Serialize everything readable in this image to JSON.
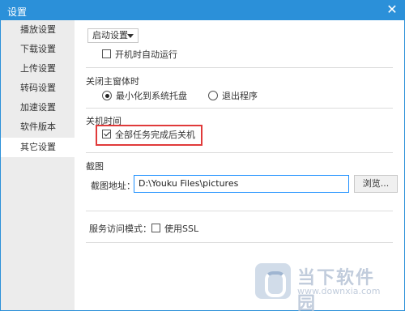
{
  "window": {
    "title": "设置",
    "close_glyph": "✕"
  },
  "sidebar": {
    "items": [
      {
        "label": "播放设置"
      },
      {
        "label": "下载设置"
      },
      {
        "label": "上传设置"
      },
      {
        "label": "转码设置"
      },
      {
        "label": "加速设置"
      },
      {
        "label": "软件版本"
      },
      {
        "label": "其它设置"
      }
    ],
    "active_index": 6
  },
  "startup": {
    "dropdown_label": "启动设置",
    "autorun_label": "开机时自动运行",
    "autorun_checked": false
  },
  "close_main": {
    "title": "关闭主窗体时",
    "option_minimize": "最小化到系统托盘",
    "option_exit": "退出程序",
    "selected": "minimize"
  },
  "shutdown": {
    "title": "关机时间",
    "option_label": "全部任务完成后关机",
    "checked": true
  },
  "screenshot": {
    "title": "截图",
    "path_label": "截图地址：",
    "path_value": "D:\\Youku Files\\pictures",
    "browse_label": "浏览..."
  },
  "service": {
    "label": "服务访问模式：",
    "ssl_label": "使用SSL",
    "ssl_checked": false
  },
  "watermark": {
    "title": "当下软件园",
    "url": "www.downxia.com"
  },
  "colors": {
    "titlebar": "#2b90d9",
    "highlight_border": "#e03a3a",
    "input_border": "#1e90ff"
  },
  "icons": {
    "close": "close-icon",
    "dropdown": "chevron-down-icon",
    "watermark_logo": "downxia-logo-icon"
  }
}
